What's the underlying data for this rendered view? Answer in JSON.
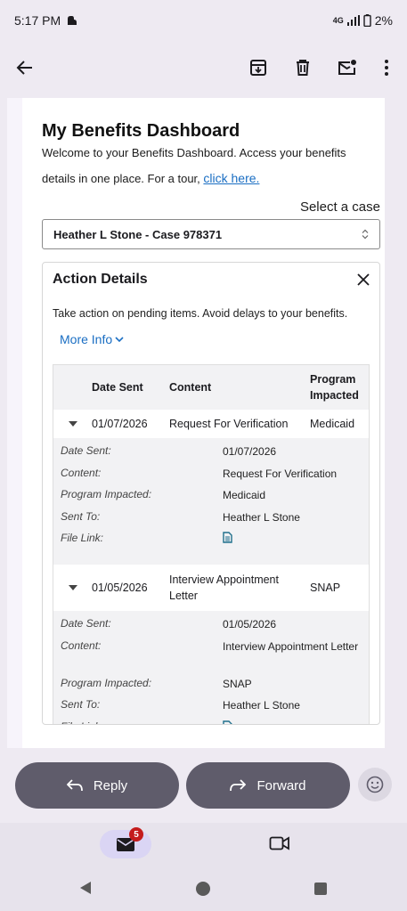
{
  "status": {
    "time": "5:17 PM",
    "network": "4G",
    "battery": "2%"
  },
  "page": {
    "title": "My Benefits Dashboard",
    "intro_line1": "Welcome to your Benefits Dashboard. Access your benefits",
    "intro_line2": "details in one place. For a tour,",
    "intro_link": "click here.",
    "select_label": "Select a case",
    "select_value": "Heather L Stone - Case 978371"
  },
  "panel": {
    "title": "Action Details",
    "text": "Take action on pending items. Avoid delays to your benefits.",
    "more_info": "More Info",
    "headers": {
      "date": "Date Sent",
      "content": "Content",
      "program": "Program Impacted"
    },
    "detail_labels": {
      "date": "Date Sent:",
      "content": "Content:",
      "program": "Program Impacted:",
      "sent_to": "Sent To:",
      "file_link": "File Link:"
    },
    "rows": [
      {
        "date": "01/07/2026",
        "content": "Request For Verification",
        "program": "Medicaid",
        "sent_to": "Heather L Stone"
      },
      {
        "date": "01/05/2026",
        "content": "Interview Appointment Letter",
        "program": "SNAP",
        "sent_to": "Heather L Stone"
      }
    ]
  },
  "actions": {
    "reply": "Reply",
    "forward": "Forward"
  },
  "nav": {
    "mail_badge": "5"
  },
  "colors": {
    "link": "#1a6ec3",
    "pill": "#5f5c6b",
    "badge": "#c41c1c"
  }
}
